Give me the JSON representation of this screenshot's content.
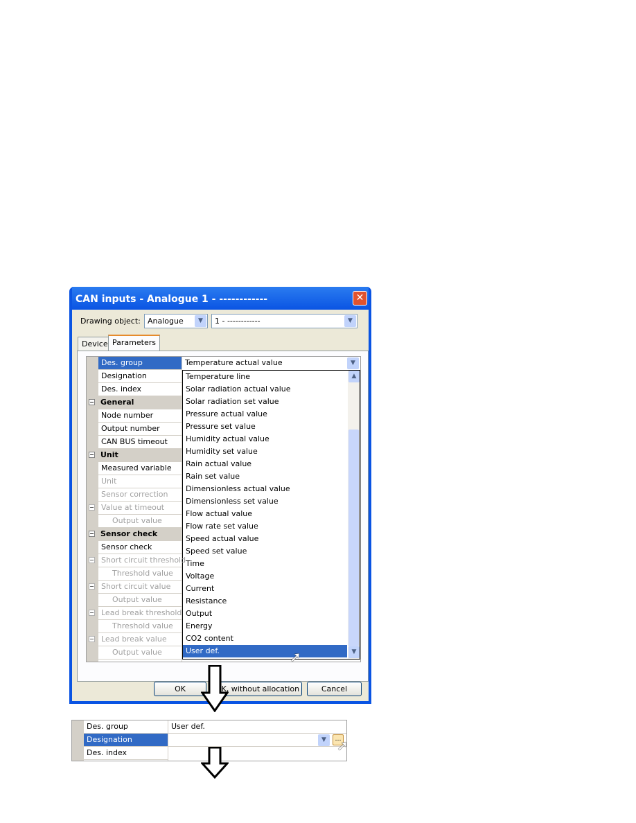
{
  "dialog": {
    "title": "CAN inputs - Analogue 1 - ------------",
    "drawing_object_label": "Drawing object:",
    "drawing_object_type": "Analogue",
    "drawing_object_item": "1 - ------------",
    "tabs": [
      {
        "label": "Device",
        "active": false
      },
      {
        "label": "Parameters",
        "active": true
      }
    ],
    "grid_rows": [
      {
        "label": "Des. group",
        "state": "selected"
      },
      {
        "label": "Designation",
        "state": "normal"
      },
      {
        "label": "Des. index",
        "state": "normal"
      },
      {
        "label": "General",
        "state": "header"
      },
      {
        "label": "Node number",
        "state": "normal"
      },
      {
        "label": "Output number",
        "state": "normal"
      },
      {
        "label": "CAN BUS timeout",
        "state": "normal"
      },
      {
        "label": "Unit",
        "state": "header"
      },
      {
        "label": "Measured variable",
        "state": "normal"
      },
      {
        "label": "Unit",
        "state": "disabled"
      },
      {
        "label": "Sensor correction",
        "state": "disabled"
      },
      {
        "label": "Value at timeout",
        "state": "disabled-group"
      },
      {
        "label": "Output value",
        "state": "disabled-indent"
      },
      {
        "label": "Sensor check",
        "state": "header"
      },
      {
        "label": "Sensor check",
        "state": "normal"
      },
      {
        "label": "Short circuit threshold",
        "state": "disabled-group"
      },
      {
        "label": "Threshold value",
        "state": "disabled-indent"
      },
      {
        "label": "Short circuit value",
        "state": "disabled-group"
      },
      {
        "label": "Output value",
        "state": "disabled-indent"
      },
      {
        "label": "Lead break threshold",
        "state": "disabled-group"
      },
      {
        "label": "Threshold value",
        "state": "disabled-indent"
      },
      {
        "label": "Lead break value",
        "state": "disabled-group"
      },
      {
        "label": "Output value",
        "state": "disabled-indent"
      }
    ],
    "des_group_value": "Temperature actual value",
    "dropdown_options": [
      "Temperature line",
      "Solar radiation actual value",
      "Solar radiation set value",
      "Pressure actual value",
      "Pressure set value",
      "Humidity actual value",
      "Humidity set value",
      "Rain actual value",
      "Rain set value",
      "Dimensionless actual value",
      "Dimensionless set value",
      "Flow actual value",
      "Flow rate set value",
      "Speed actual value",
      "Speed set value",
      "Time",
      "Voltage",
      "Current",
      "Resistance",
      "Output",
      "Energy",
      "CO2 content",
      "User def."
    ],
    "dropdown_selected": "User def.",
    "buttons": {
      "ok": "OK",
      "ok_without_allocation": "OK, without allocation",
      "cancel": "Cancel"
    }
  },
  "result_grid": {
    "rows": [
      {
        "label": "Des. group",
        "value": "User def."
      },
      {
        "label": "Designation",
        "value": ""
      },
      {
        "label": "Des. index",
        "value": ""
      }
    ]
  },
  "colors": {
    "selection": "#316ac5",
    "titlebar": "#0a54e3",
    "close": "#e0532f"
  }
}
